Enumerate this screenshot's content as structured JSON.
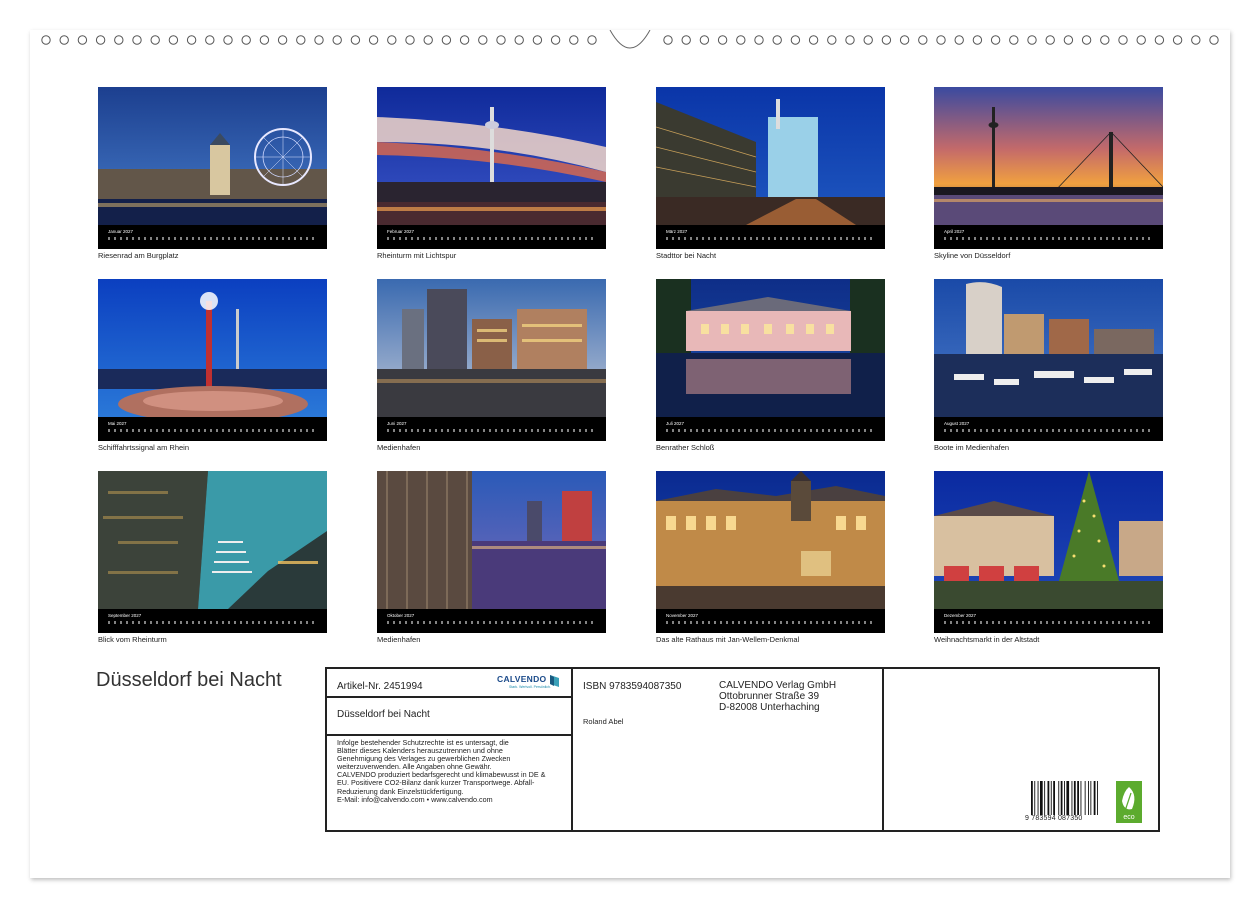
{
  "calendar_title": "Düsseldorf bei Nacht",
  "months": [
    {
      "month_label": "Januar 2027",
      "caption": "Riesenrad am Burgplatz"
    },
    {
      "month_label": "Februar 2027",
      "caption": "Rheinturm mit Lichtspur"
    },
    {
      "month_label": "März 2027",
      "caption": "Stadttor bei Nacht"
    },
    {
      "month_label": "April 2027",
      "caption": "Skyline von Düsseldorf"
    },
    {
      "month_label": "Mai 2027",
      "caption": "Schifffahrtssignal am Rhein"
    },
    {
      "month_label": "Juni 2027",
      "caption": "Medienhafen"
    },
    {
      "month_label": "Juli 2027",
      "caption": "Benrather Schloß"
    },
    {
      "month_label": "August 2027",
      "caption": "Boote im Medienhafen"
    },
    {
      "month_label": "September 2027",
      "caption": "Blick vom Rheinturm"
    },
    {
      "month_label": "Oktober 2027",
      "caption": "Medienhafen"
    },
    {
      "month_label": "November 2027",
      "caption": "Das alte Rathaus mit Jan-Wellem-Denkmal"
    },
    {
      "month_label": "Dezember 2027",
      "caption": "Weihnachtsmarkt in der Altstadt"
    }
  ],
  "info": {
    "article_no": "Artikel-Nr. 2451994",
    "logo_text": "CALVENDO",
    "logo_subtext": "Stark. Wertvoll. Persönlich.",
    "title": "Düsseldorf bei Nacht",
    "isbn": "ISBN 9783594087350",
    "author": "Roland Abel",
    "publisher_lines": [
      "CALVENDO Verlag GmbH",
      "Ottobrunner Straße 39",
      "D-82008 Unterhaching"
    ],
    "notice_lines": [
      "Infolge bestehender Schutzrechte ist es untersagt, die",
      "Blätter dieses Kalenders herauszutrennen und ohne",
      "Genehmigung des Verlages zu gewerblichen Zwecken",
      "weiterzuverwenden. Alle Angaben ohne Gewähr.",
      "CALVENDO produziert bedarfsgerecht und klimabewusst in DE &",
      "EU. Positivere CO2-Bilanz dank kurzer Transportwege. Abfall-",
      "Reduzierung dank Einzelstückfertigung.",
      "E-Mail: info@calvendo.com • www.calvendo.com"
    ],
    "barcode_digits": "9 783594 087350",
    "eco_label": "eco"
  },
  "colors": {
    "info_border": "#222222",
    "logo_blue": "#1a4a8a",
    "eco_green": "#5cab2e"
  }
}
